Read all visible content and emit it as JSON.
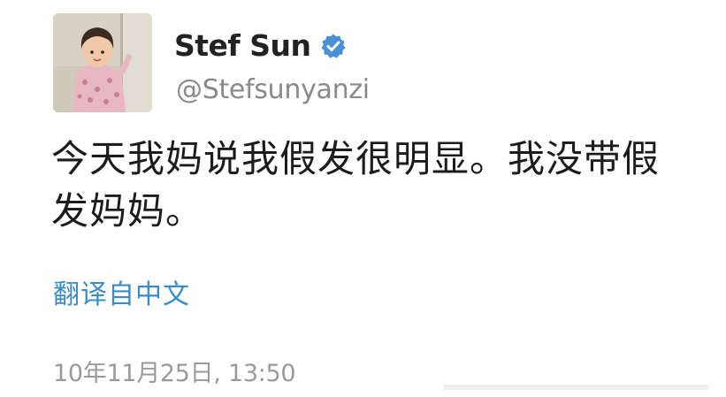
{
  "user": {
    "display_name": "Stef Sun",
    "handle": "@Stefsunyanzi",
    "verified": true,
    "avatar_icon": "avatar-photo-child"
  },
  "tweet": {
    "text": "今天我妈说我假发很明显。我没带假\n发妈妈。",
    "translate_label": "翻译自中文",
    "timestamp": "10年11月25日, 13:50"
  },
  "colors": {
    "background": "#ffffff",
    "name": "#222222",
    "handle": "#8a8a8a",
    "text": "#1c1c1c",
    "link": "#3a8cc9",
    "timestamp": "#9a9a9a",
    "verified_badge": "#4a90d9"
  }
}
